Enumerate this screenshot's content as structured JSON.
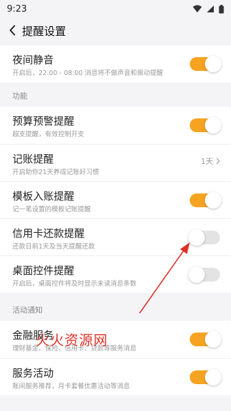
{
  "status": {
    "time": "9:23"
  },
  "header": {
    "title": "提醒设置"
  },
  "night": {
    "title": "夜间静音",
    "subtitle": "开启后，22:00 - 08:00 消息将不做声音和振动提醒",
    "enabled": true
  },
  "section_function": "功能",
  "function_items": [
    {
      "title": "预算预警提醒",
      "subtitle": "超支提醒，有效控制开支",
      "enabled": true
    },
    {
      "title": "记账提醒",
      "subtitle": "开启助你21天养成记账好习惯",
      "value": "1天"
    },
    {
      "title": "模板入账提醒",
      "subtitle": "记一笔设置的模板记账提醒",
      "enabled": true
    },
    {
      "title": "信用卡还款提醒",
      "subtitle": "还款日前1天及当天提醒还款",
      "enabled": false
    },
    {
      "title": "桌面控件提醒",
      "subtitle": "开启后，桌面控件将及时显示未读消息条数",
      "enabled": false
    }
  ],
  "section_activity": "活动通知",
  "activity_items": [
    {
      "title": "金融服务",
      "subtitle": "理财基金、保险、信用卡、贷款等服务消息",
      "enabled": true
    },
    {
      "title": "服务活动",
      "subtitle": "账间服务推荐，月卡套餐优惠活动等消息",
      "enabled": true
    }
  ],
  "watermark": "火火资源网",
  "colors": {
    "accent": "#f6a322",
    "annotation": "#e0302a"
  }
}
